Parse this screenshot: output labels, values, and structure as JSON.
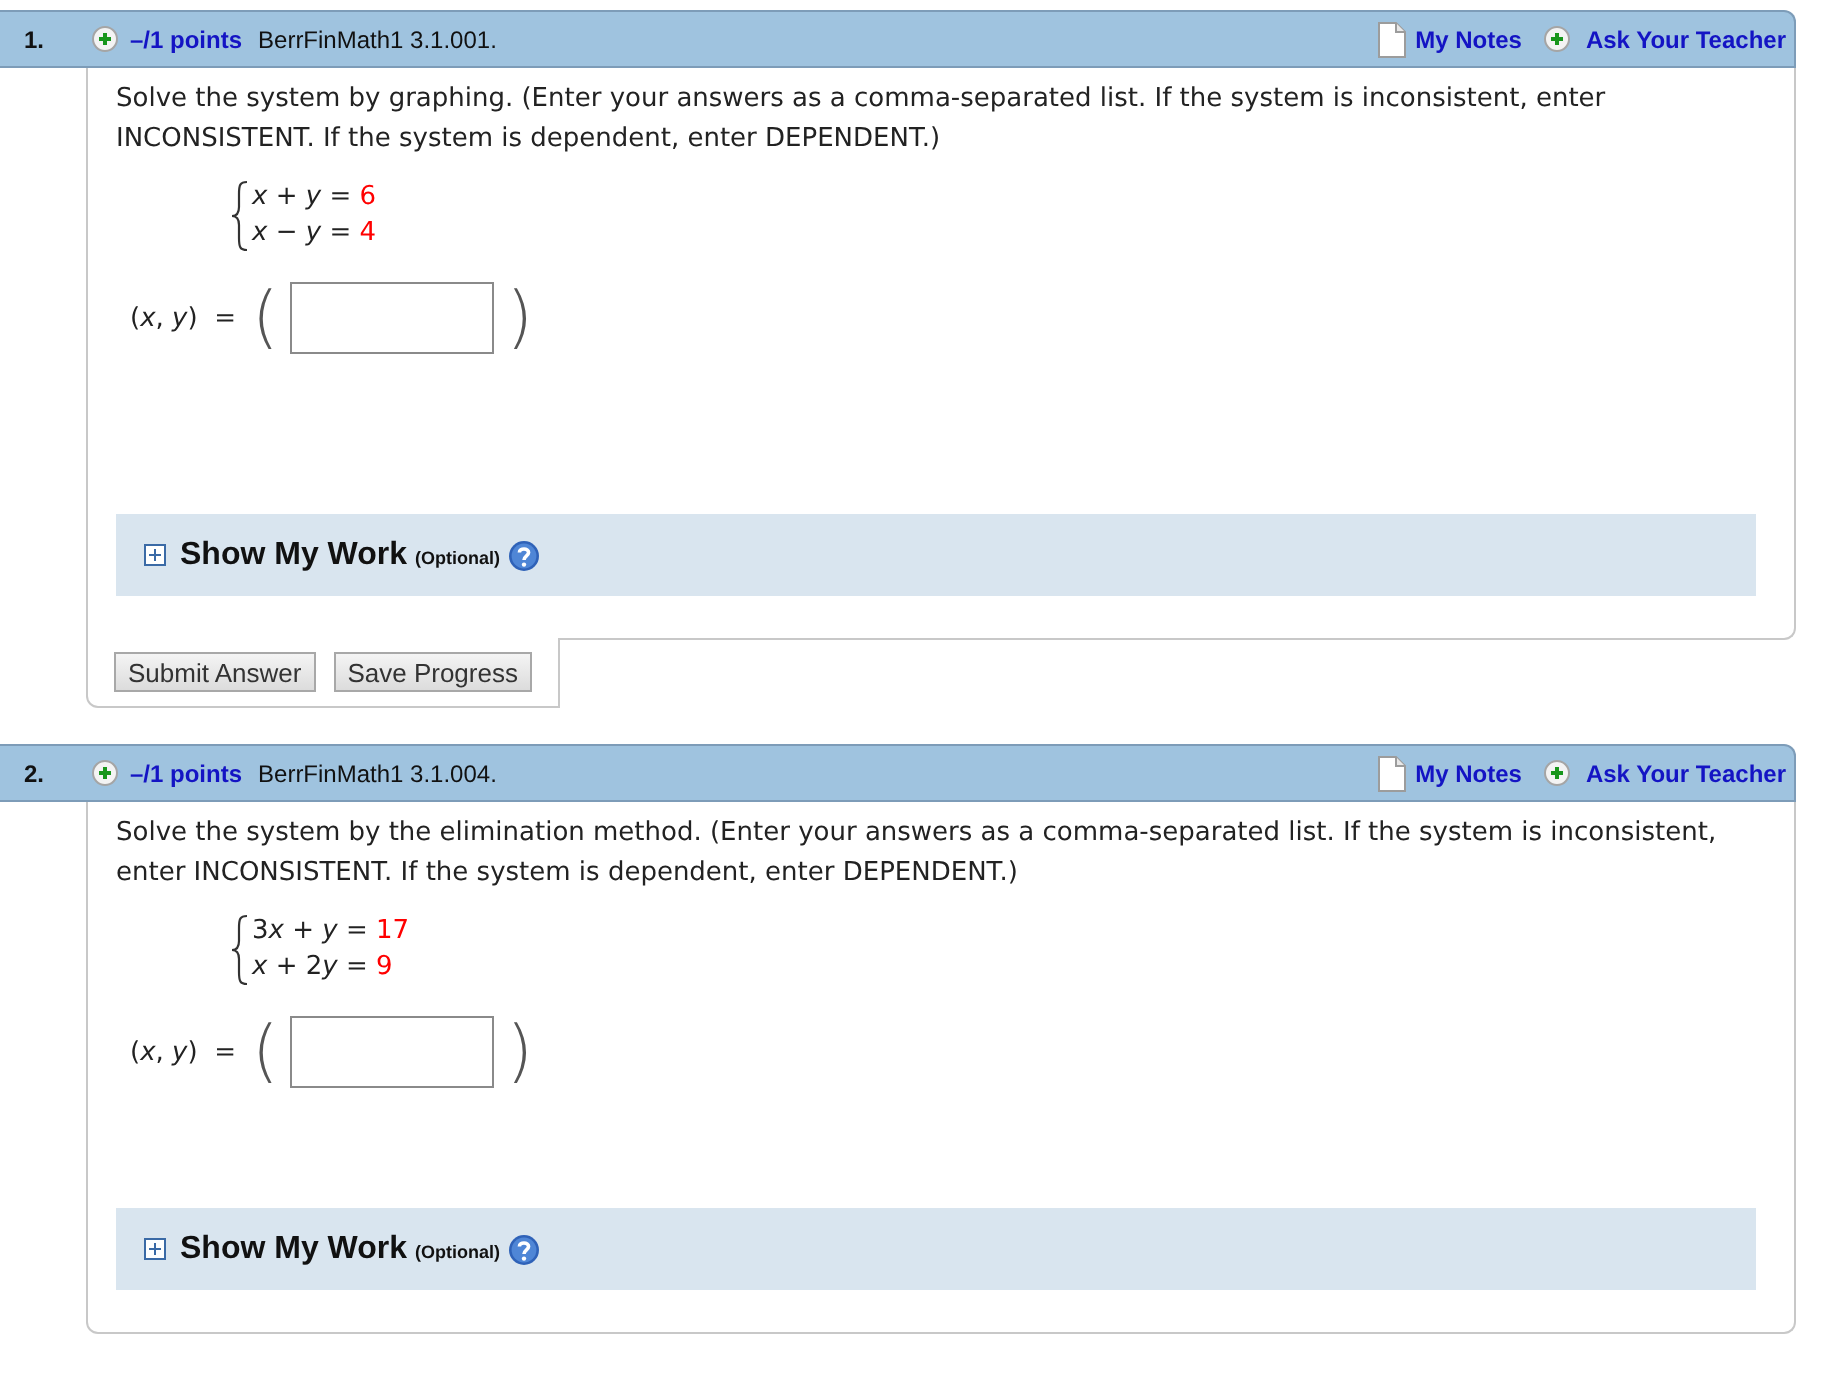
{
  "questions": [
    {
      "number": "1.",
      "points": "–/1 points",
      "source": "BerrFinMath1 3.1.001.",
      "links": [
        {
          "label": "My Notes",
          "kind": "notes"
        },
        {
          "label": "Ask Your Teacher",
          "kind": "ask"
        }
      ],
      "prompt": "Solve the system by graphing. (Enter your answers as a comma-separated list. If the system is inconsistent, enter INCONSISTENT. If the system is dependent, enter DEPENDENT.)",
      "equations": [
        {
          "terms": [
            {
              "kind": "var",
              "text": "x"
            },
            {
              "kind": "op",
              "text": "+"
            },
            {
              "kind": "var",
              "text": "y"
            },
            {
              "kind": "op",
              "text": "="
            },
            {
              "kind": "value",
              "text": "6"
            }
          ]
        },
        {
          "terms": [
            {
              "kind": "var",
              "text": "x"
            },
            {
              "kind": "op",
              "text": "−"
            },
            {
              "kind": "var",
              "text": "y"
            },
            {
              "kind": "op",
              "text": "="
            },
            {
              "kind": "value",
              "text": "4"
            }
          ]
        }
      ],
      "answer": {
        "label": "(*x*, *y*)  =",
        "open": "(",
        "close": ")"
      },
      "show_work": {
        "title": "Show My Work",
        "note": "(Optional)",
        "expanded": false
      },
      "buttons": [
        "Submit Answer",
        "Save Progress"
      ]
    },
    {
      "number": "2.",
      "points": "–/1 points",
      "source": "BerrFinMath1 3.1.004.",
      "links": [
        {
          "label": "My Notes",
          "kind": "notes"
        },
        {
          "label": "Ask Your Teacher",
          "kind": "ask"
        }
      ],
      "prompt": "Solve the system by the elimination method. (Enter your answers as a comma-separated list. If the system is inconsistent, enter INCONSISTENT. If the system is dependent, enter DEPENDENT.)",
      "equations": [
        {
          "terms": [
            {
              "kind": "num",
              "text": "3"
            },
            {
              "kind": "var",
              "text": "x"
            },
            {
              "kind": "op",
              "text": "+"
            },
            {
              "kind": "var",
              "text": "y"
            },
            {
              "kind": "op",
              "text": "="
            },
            {
              "kind": "value",
              "text": "17"
            }
          ]
        },
        {
          "terms": [
            {
              "kind": "var",
              "text": "x"
            },
            {
              "kind": "op",
              "text": "+"
            },
            {
              "kind": "num",
              "text": "2"
            },
            {
              "kind": "var",
              "text": "y"
            },
            {
              "kind": "op",
              "text": "="
            },
            {
              "kind": "value",
              "text": "9"
            }
          ]
        }
      ],
      "answer": {
        "label": "(*x*, *y*)  =",
        "open": "(",
        "close": ")"
      },
      "show_work": {
        "title": "Show My Work",
        "note": "(Optional)",
        "expanded": false
      }
    }
  ]
}
